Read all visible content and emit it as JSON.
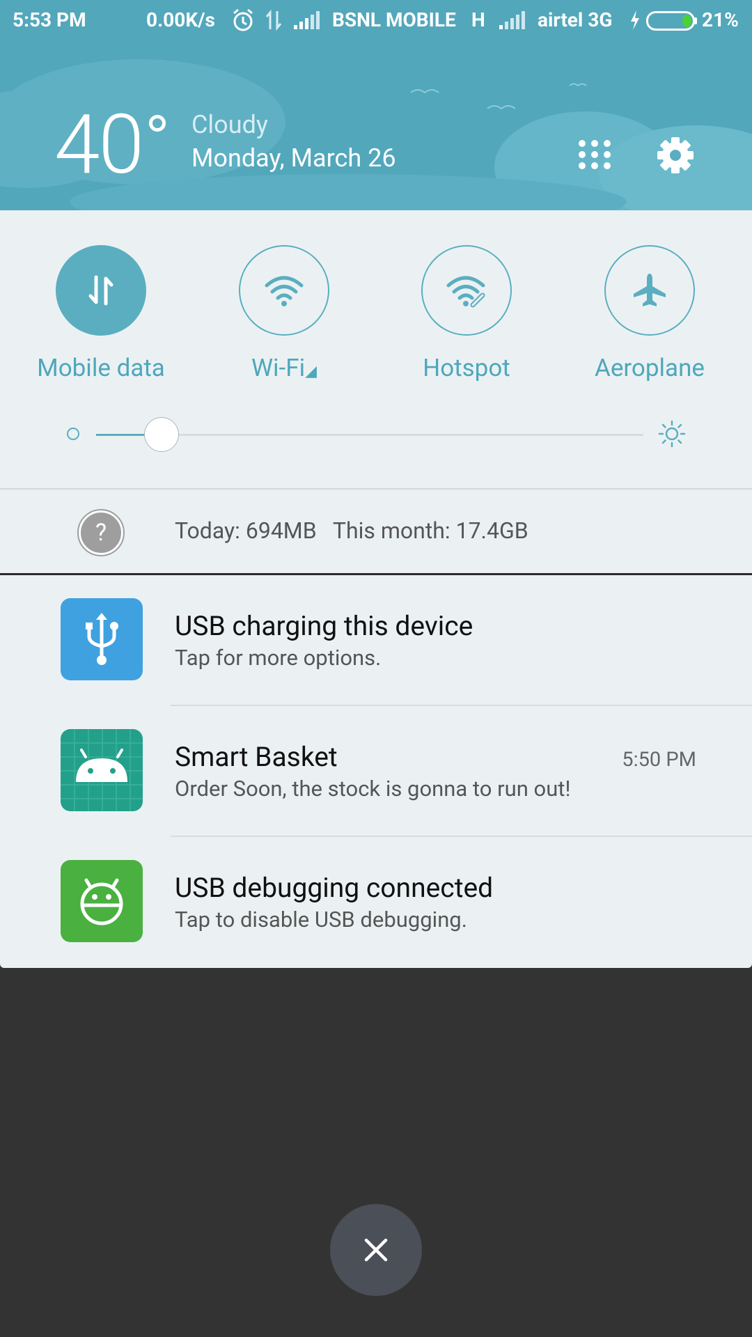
{
  "status_bar": {
    "time": "5:53 PM",
    "net_speed": "0.00K/s",
    "carrier1": "BSNL MOBILE",
    "carrier1_type": "H",
    "carrier2": "airtel 3G",
    "battery_percent": "21%",
    "battery_level": 0.21,
    "icons": [
      "alarm-icon",
      "data-arrows-icon",
      "signal-icon",
      "signal-icon",
      "charging-icon",
      "battery-icon"
    ]
  },
  "weather": {
    "temperature": "40",
    "condition": "Cloudy",
    "date": "Monday, March 26"
  },
  "header_icons": [
    "apps-grid-icon",
    "settings-gear-icon"
  ],
  "toggles": [
    {
      "label": "Mobile data",
      "icon": "mobile-data-icon",
      "active": true
    },
    {
      "label": "Wi-Fi",
      "icon": "wifi-icon",
      "active": false
    },
    {
      "label": "Hotspot",
      "icon": "hotspot-icon",
      "active": false
    },
    {
      "label": "Aeroplane",
      "icon": "airplane-icon",
      "active": false
    }
  ],
  "brightness": {
    "level": 0.12
  },
  "data_usage": {
    "text": "Today: 694MB   This month: 17.4GB",
    "icon": "help-icon"
  },
  "notifications": [
    {
      "title": "USB charging this device",
      "text": "Tap for more options.",
      "time": "",
      "icon": "usb-icon",
      "color": "#3fa1e0"
    },
    {
      "title": "Smart Basket",
      "text": "Order Soon, the stock is gonna to run out!",
      "time": "5:50 PM",
      "icon": "android-icon",
      "color": "#22a08a"
    },
    {
      "title": "USB debugging connected",
      "text": "Tap to disable USB debugging.",
      "time": "",
      "icon": "android-debug-icon",
      "color": "#4ab040"
    }
  ],
  "close_button": {
    "icon": "close-icon"
  },
  "colors": {
    "accent": "#5aaec0",
    "panel": "#ebf1f3",
    "backdrop": "#333333"
  }
}
